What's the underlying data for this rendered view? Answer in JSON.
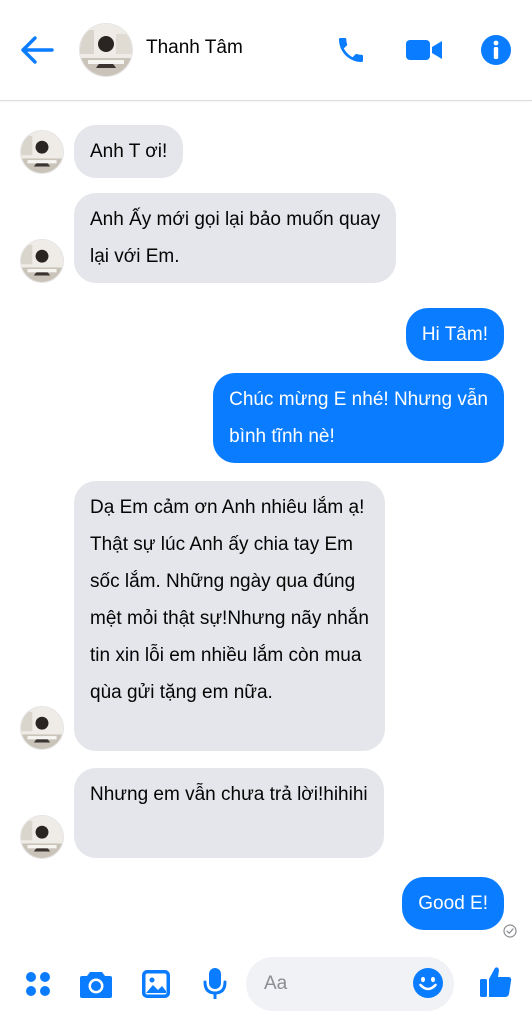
{
  "colors": {
    "accent": "#0a7cff",
    "incoming_bubble": "#e4e6eb"
  },
  "header": {
    "contact_name": "Thanh Tâm",
    "icons": [
      "back-arrow-icon",
      "phone-icon",
      "video-camera-icon",
      "info-icon"
    ]
  },
  "messages": [
    {
      "from": "contact",
      "text": "Anh T ơi!"
    },
    {
      "from": "contact",
      "text": "Anh Ấy mới gọi lại bảo muốn quay\nlại với Em."
    },
    {
      "from": "me",
      "text": "Hi Tâm!"
    },
    {
      "from": "me",
      "text": "Chúc mừng E nhé! Nhưng vẫn\nbình tĩnh nè!"
    },
    {
      "from": "contact",
      "text": "Dạ Em cảm ơn Anh nhiêu lắm ạ!\nThật sự lúc Anh ấy chia tay Em\nsốc lắm. Những ngày qua đúng\nmệt mỏi thật sự!Nhưng nãy nhắn\ntin xin lỗi em nhiều lắm còn mua\nqùa gửi tặng em nữa."
    },
    {
      "from": "contact",
      "text": "Nhưng em vẫn chưa trả lời!hihihi"
    },
    {
      "from": "me",
      "text": "Good E!"
    }
  ],
  "composer": {
    "placeholder": "Aa",
    "icons": [
      "apps-grid-icon",
      "camera-icon",
      "gallery-icon",
      "microphone-icon",
      "emoji-icon",
      "like-icon"
    ]
  }
}
